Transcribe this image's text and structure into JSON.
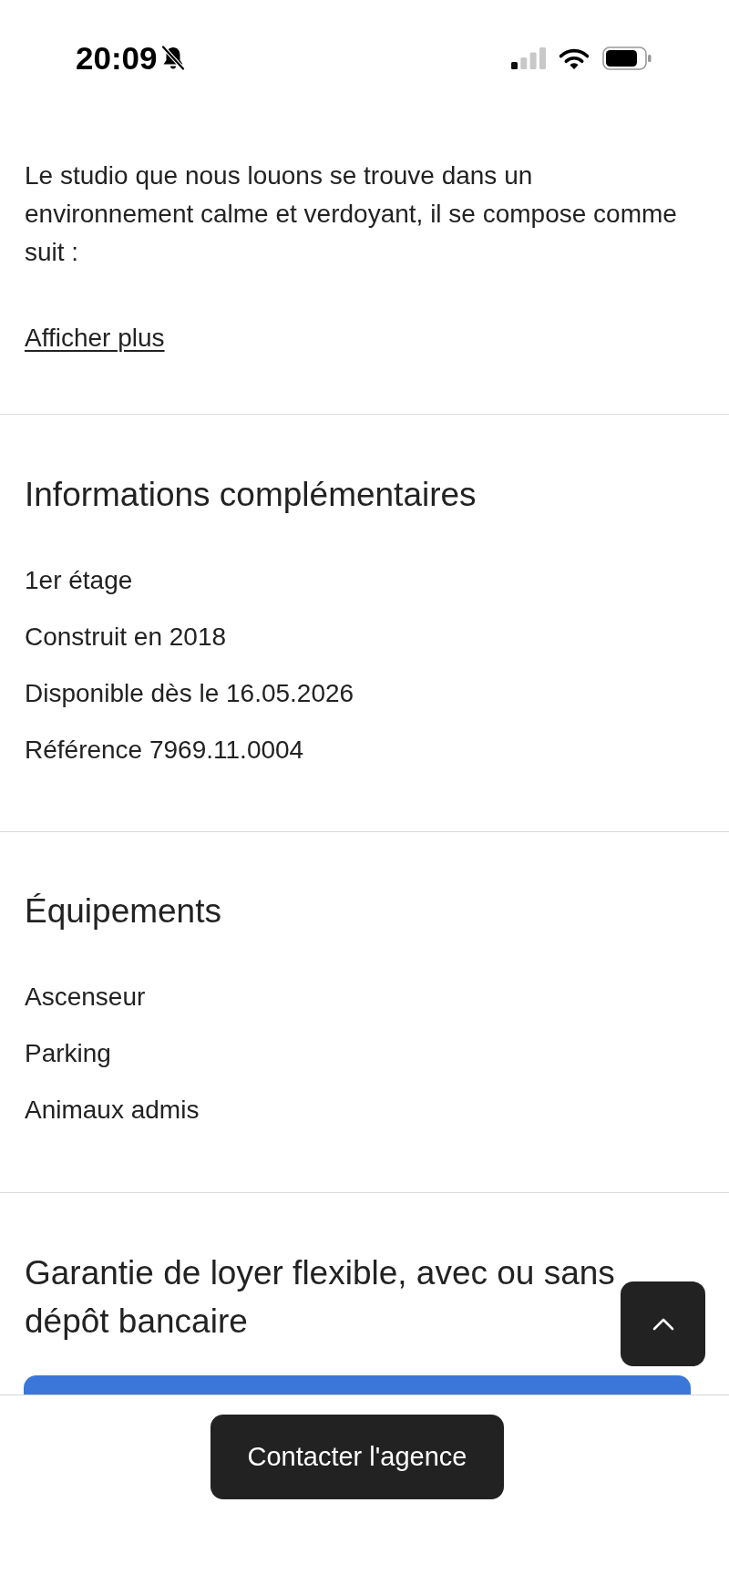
{
  "status_bar": {
    "time": "20:09",
    "silent": true
  },
  "description": {
    "text": "Le studio que nous louons se trouve dans un environnement calme et verdoyant, il se compose comme suit :",
    "more_link": "Afficher plus"
  },
  "sections": [
    {
      "title": "Informations complémentaires",
      "items": [
        "1er étage",
        "Construit en 2018",
        "Disponible dès le 16.05.2026",
        "Référence 7969.11.0004"
      ]
    },
    {
      "title": "Équipements",
      "items": [
        "Ascenseur",
        "Parking",
        "Animaux admis"
      ]
    }
  ],
  "guarantee": {
    "title": "Garantie de loyer flexible, avec ou sans dépôt bancaire"
  },
  "contact_button": {
    "label": "Contacter l'agence"
  }
}
